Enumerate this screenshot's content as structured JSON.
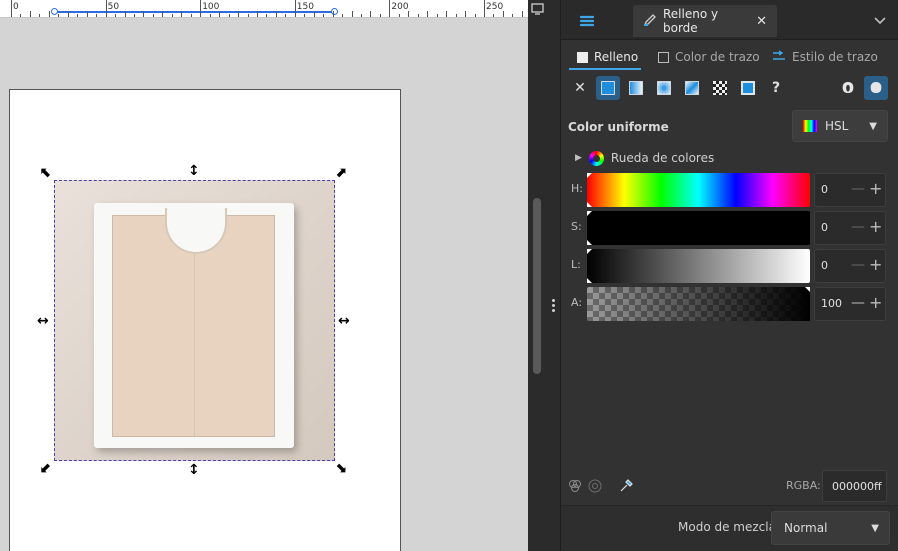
{
  "ruler": {
    "labels": [
      "0",
      "50",
      "100",
      "150",
      "200",
      "250"
    ]
  },
  "panel": {
    "tab_title": "Relleno y borde",
    "tab_close": "✕",
    "icons": {
      "panel_tab": "layers-stack-icon",
      "pen": "pen-edit-icon",
      "collapse": "chevron-down-icon"
    }
  },
  "subtabs": {
    "fill": "Relleno",
    "stroke_paint": "Color de trazo",
    "stroke_style": "Estilo de trazo"
  },
  "fill_types": [
    {
      "name": "no-paint-button",
      "glyph": "✕"
    },
    {
      "name": "flat-color-button",
      "glyph": ""
    },
    {
      "name": "linear-gradient-button",
      "glyph": ""
    },
    {
      "name": "radial-gradient-button",
      "glyph": ""
    },
    {
      "name": "mesh-gradient-button",
      "glyph": ""
    },
    {
      "name": "pattern-button",
      "glyph": ""
    },
    {
      "name": "swatch-button",
      "glyph": ""
    },
    {
      "name": "unset-paint-button",
      "glyph": "?"
    }
  ],
  "fill": {
    "mode_title": "Color uniforme",
    "mode_value": "HSL",
    "wheel_label": "Rueda de colores",
    "accent": "#3ea7e8"
  },
  "sliders": [
    {
      "channel": "H:",
      "value": "0"
    },
    {
      "channel": "S:",
      "value": "0"
    },
    {
      "channel": "L:",
      "value": "0"
    },
    {
      "channel": "A:",
      "value": "100"
    }
  ],
  "rgba": {
    "label": "RGBA:",
    "value": "000000ff"
  },
  "blend": {
    "label": "Modo de mezcla:",
    "value": "Normal"
  }
}
